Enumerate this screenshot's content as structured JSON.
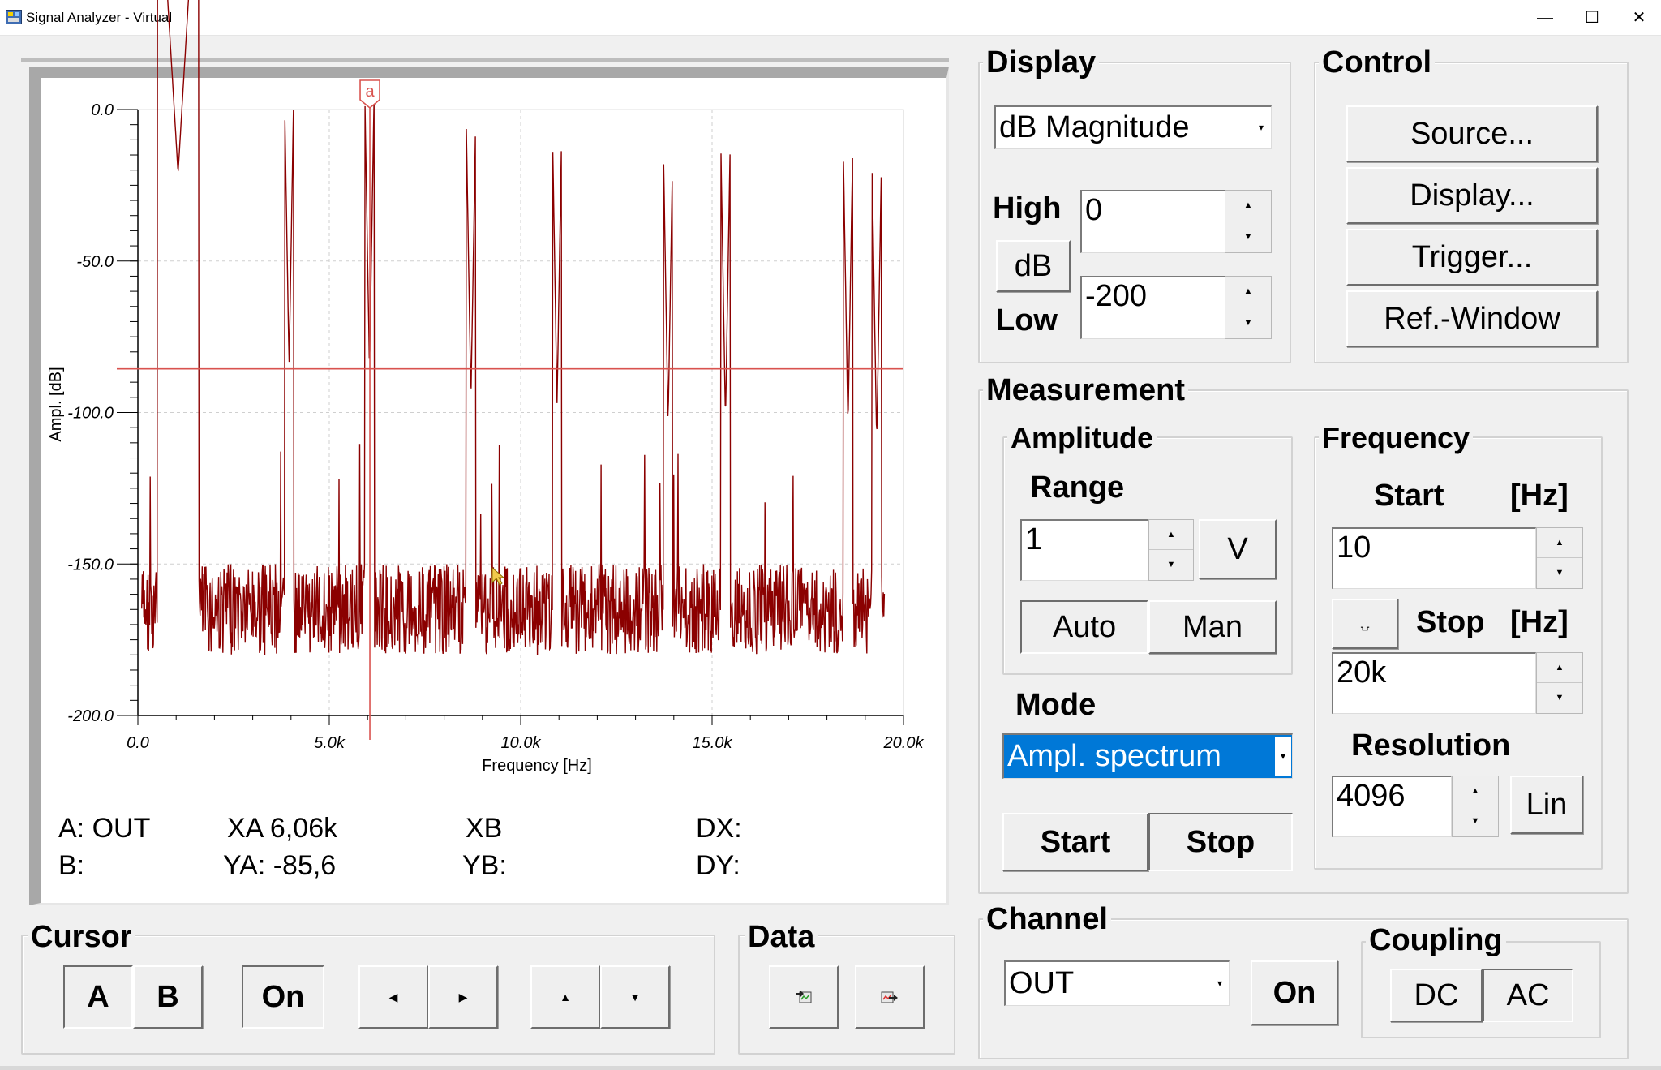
{
  "window": {
    "title": "Signal Analyzer - Virtual"
  },
  "chart": {
    "cursor_marker": "a",
    "chart_data": {
      "type": "line",
      "title": "",
      "xlabel": "Frequency [Hz]",
      "ylabel": "Ampl. [dB]",
      "xlim": [
        0,
        20000
      ],
      "ylim": [
        -200,
        0
      ],
      "x_ticks": [
        "0.0",
        "5.0k",
        "10.0k",
        "15.0k",
        "20.0k"
      ],
      "y_ticks": [
        "0.0",
        "-50.0",
        "-100.0",
        "-150.0",
        "-200.0"
      ],
      "grid": true,
      "series_color": "#8b0000",
      "cursor": {
        "x": 6060,
        "y": -85.6,
        "color": "#d9534f"
      },
      "noise_floor": [
        -150,
        -180
      ],
      "peaks": [
        {
          "x": 1050,
          "y": -21
        },
        {
          "x": 3950,
          "y": -85
        },
        {
          "x": 6050,
          "y": -86
        },
        {
          "x": 8700,
          "y": -96
        },
        {
          "x": 10950,
          "y": -97
        },
        {
          "x": 13850,
          "y": -104
        },
        {
          "x": 15350,
          "y": -103
        },
        {
          "x": 18550,
          "y": -105
        },
        {
          "x": 19300,
          "y": -110
        }
      ]
    }
  },
  "readout": {
    "a_label": "A: OUT",
    "b_label": "B:",
    "xa": "XA 6,06k",
    "ya": "YA: -85,6",
    "xb": "XB",
    "yb": "YB:",
    "dx": "DX:",
    "dy": "DY:"
  },
  "display": {
    "title": "Display",
    "mode_value": "dB Magnitude",
    "high_label": "High",
    "high_value": "0",
    "db_button": "dB",
    "low_label": "Low",
    "low_value": "-200"
  },
  "control": {
    "title": "Control",
    "buttons": [
      "Source...",
      "Display...",
      "Trigger...",
      "Ref.-Window"
    ]
  },
  "measurement": {
    "title": "Measurement",
    "amplitude": {
      "title": "Amplitude",
      "range_label": "Range",
      "range_value": "1",
      "unit_button": "V",
      "auto_button": "Auto",
      "man_button": "Man"
    },
    "mode_label": "Mode",
    "mode_value": "Ampl. spectrum",
    "start_button": "Start",
    "stop_button": "Stop",
    "frequency": {
      "title": "Frequency",
      "start_label": "Start",
      "start_unit": "[Hz]",
      "start_value": "10",
      "stop_label": "Stop",
      "stop_unit": "[Hz]",
      "stop_value": "20k",
      "resolution_label": "Resolution",
      "resolution_value": "4096",
      "scale_button": "Lin"
    }
  },
  "cursor": {
    "title": "Cursor",
    "a_button": "A",
    "b_button": "B",
    "on_button": "On"
  },
  "data_group": {
    "title": "Data"
  },
  "channel": {
    "title": "Channel",
    "value": "OUT",
    "on_button": "On",
    "coupling": {
      "title": "Coupling",
      "dc_button": "DC",
      "ac_button": "AC"
    }
  }
}
